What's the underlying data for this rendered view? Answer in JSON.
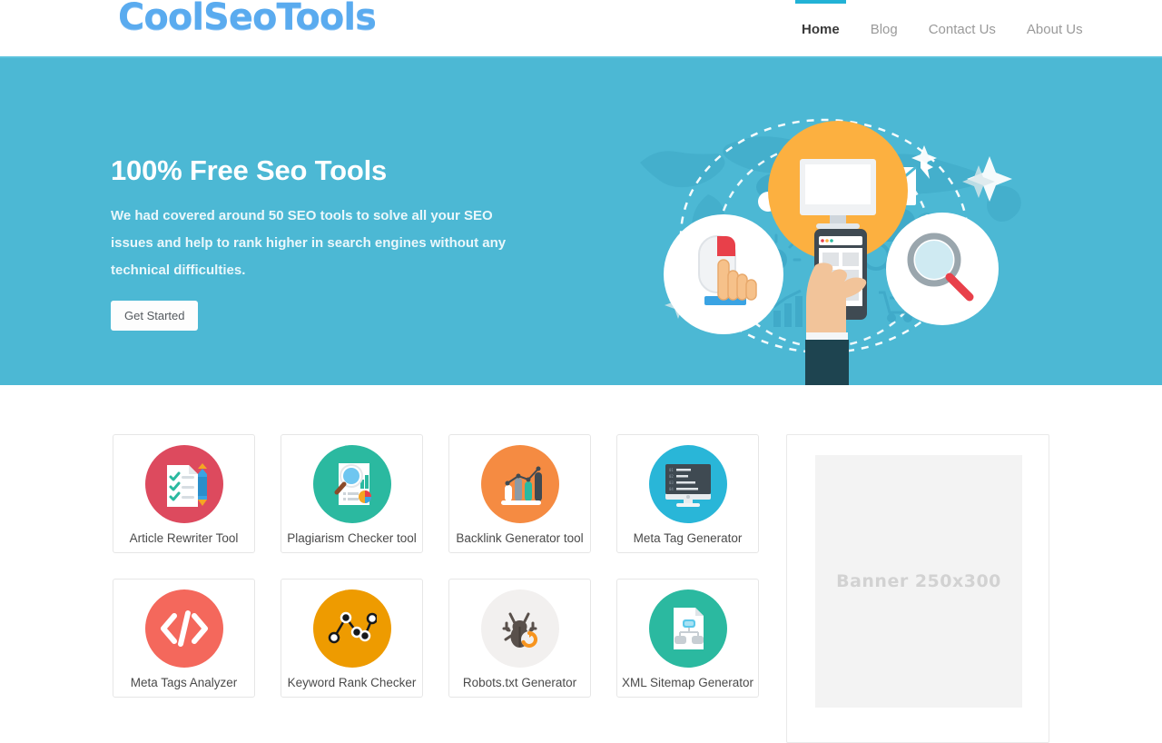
{
  "header": {
    "logo": "CoolSeoTools",
    "nav": [
      {
        "label": "Home",
        "active": true
      },
      {
        "label": "Blog",
        "active": false
      },
      {
        "label": "Contact Us",
        "active": false
      },
      {
        "label": "About Us",
        "active": false
      }
    ]
  },
  "hero": {
    "title": "100% Free Seo Tools",
    "subtitle": "We had covered around 50 SEO tools to solve all your SEO issues and help to rank higher in search engines without any technical difficulties.",
    "cta_label": "Get Started",
    "background_color": "#4cb8d4",
    "illustration": "seo-digital-marketing-illustration"
  },
  "tools": [
    {
      "label": "Article Rewriter Tool",
      "icon": "document-checklist-pencil-icon",
      "circle_color": "#dd4a5e"
    },
    {
      "label": "Plagiarism Checker tool",
      "icon": "magnifier-report-icon",
      "circle_color": "#2bb9a0"
    },
    {
      "label": "Backlink Generator tool",
      "icon": "bar-chart-growth-icon",
      "circle_color": "#f58b42"
    },
    {
      "label": "Meta Tag Generator",
      "icon": "monitor-code-icon",
      "circle_color": "#29b6d8"
    },
    {
      "label": "Meta Tags Analyzer",
      "icon": "code-brackets-icon",
      "circle_color": "#f4685c"
    },
    {
      "label": "Keyword Rank Checker",
      "icon": "line-chart-nodes-icon",
      "circle_color": "#ee9b00"
    },
    {
      "label": "Robots.txt Generator",
      "icon": "bug-refresh-icon",
      "circle_color": "#f2f0ef"
    },
    {
      "label": "XML Sitemap Generator",
      "icon": "sitemap-document-icon",
      "circle_color": "#2bb9a0"
    }
  ],
  "banner": {
    "placeholder_text": "Banner  250x300"
  },
  "colors": {
    "accent": "#22b2d6",
    "hero": "#4cb8d4",
    "logo": "#5aabef"
  }
}
